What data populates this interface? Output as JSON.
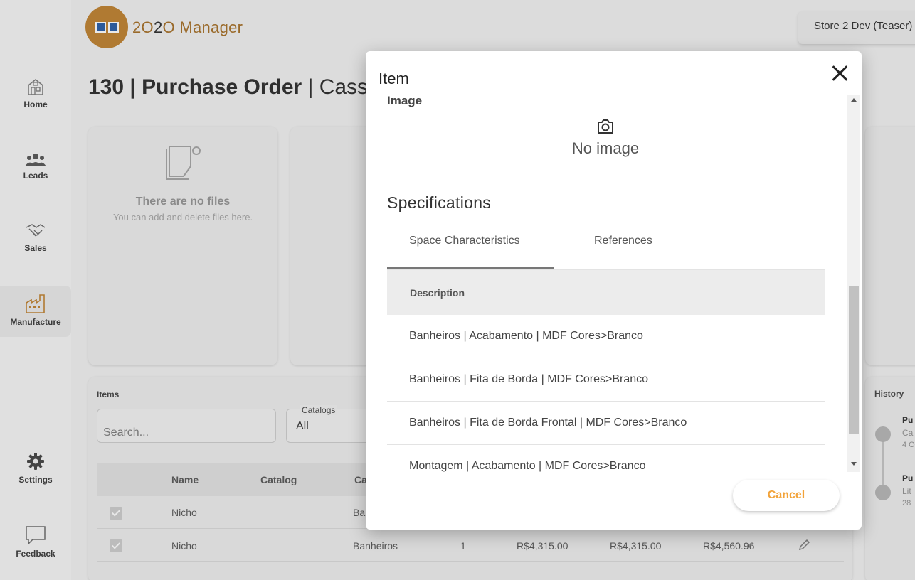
{
  "app": {
    "title_prefix": "2",
    "title_o": "O",
    "title_mid": "2",
    "title_o2": "O",
    "title_rest": " Manager",
    "store": "Store 2 Dev (Teaser)"
  },
  "nav": {
    "home": "Home",
    "leads": "Leads",
    "sales": "Sales",
    "manufacture": "Manufacture",
    "settings": "Settings",
    "feedback": "Feedback"
  },
  "page": {
    "title_bold": "130 | Purchase Order",
    "title_rest": " | Cassia"
  },
  "files": {
    "empty_title": "There are no files",
    "empty_sub": "You can add and delete files here."
  },
  "items": {
    "label": "Items",
    "search_placeholder": "Search...",
    "catalog_label": "Catalogs",
    "catalog_value": "All",
    "columns": [
      "Name",
      "Catalog",
      "Ca"
    ],
    "rows": [
      {
        "name": "Nicho",
        "category": "Ba"
      },
      {
        "name": "Nicho",
        "category": "Banheiros",
        "qty": "1",
        "price1": "R$4,315.00",
        "price2": "R$4,315.00",
        "price3": "R$4,560.96"
      }
    ]
  },
  "history": {
    "label": "History",
    "entries": [
      {
        "title": "Pu",
        "sub1": "Ca",
        "sub2": "4 O"
      },
      {
        "title": "Pu",
        "sub1": "Lit",
        "sub2": "28"
      }
    ]
  },
  "modal": {
    "title": "Item",
    "image_label": "Image",
    "no_image": "No image",
    "spec_title": "Specifications",
    "tabs": [
      "Space Characteristics",
      "References"
    ],
    "active_tab": 0,
    "desc_header": "Description",
    "rows": [
      "Banheiros | Acabamento | MDF Cores>Branco",
      "Banheiros | Fita de Borda | MDF Cores>Branco",
      "Banheiros | Fita de Borda Frontal | MDF Cores>Branco",
      "Montagem | Acabamento | MDF Cores>Branco"
    ],
    "cancel": "Cancel"
  },
  "colors": {
    "accent": "#f2a33a",
    "overlay": "#dcdcdc",
    "logo": "#b07a32"
  }
}
